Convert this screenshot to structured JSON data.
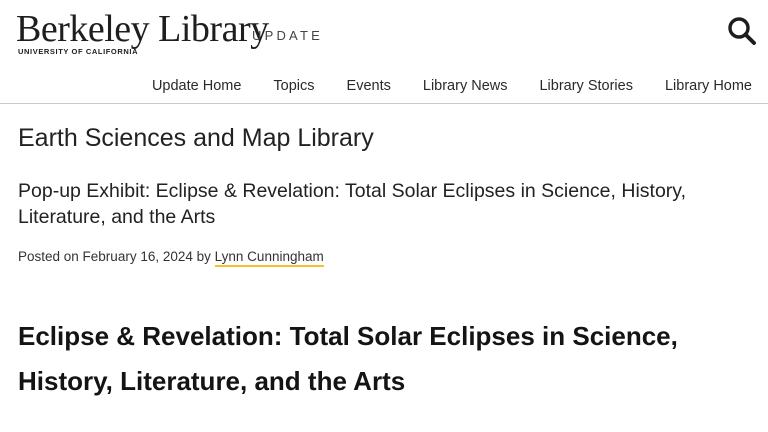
{
  "header": {
    "logo_main": "Berkeley Library",
    "logo_sub": "UNIVERSITY OF CALIFORNIA",
    "update_label": "UPDATE",
    "search_icon": "search-icon"
  },
  "nav": {
    "items": [
      {
        "label": "Update Home"
      },
      {
        "label": "Topics"
      },
      {
        "label": "Events"
      },
      {
        "label": "Library News"
      },
      {
        "label": "Library Stories"
      },
      {
        "label": "Library Home"
      }
    ]
  },
  "content": {
    "section_title": "Earth Sciences and Map Library",
    "post_title": "Pop-up Exhibit: Eclipse & Revelation: Total Solar Eclipses in Science, History, Literature, and the Arts",
    "meta_prefix": "Posted on February 16, 2024 by",
    "author": "Lynn Cunningham",
    "article_heading": "Eclipse & Revelation: Total Solar Eclipses in Science, History, Literature, and the Arts"
  },
  "colors": {
    "author_underline": "#f2c12e",
    "divider": "#c9c9c9"
  }
}
